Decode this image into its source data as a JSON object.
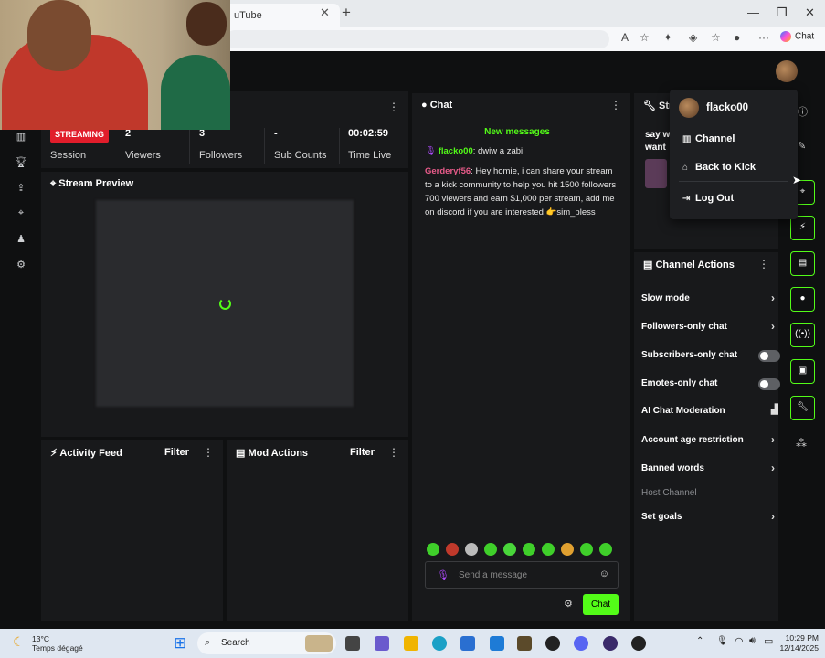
{
  "browser": {
    "tab_title": "uTube",
    "new_tab": "+",
    "chat_label": "Chat"
  },
  "stats": {
    "badge": "STREAMING",
    "session_label": "Session",
    "viewers_value": "2",
    "viewers_label": "Viewers",
    "followers_value": "3",
    "followers_label": "Followers",
    "subs_value": "-",
    "subs_label": "Sub Counts",
    "time_value": "00:02:59",
    "time_label": "Time Live"
  },
  "preview": {
    "title": "Stream Preview"
  },
  "chat": {
    "title": "Chat",
    "new_messages": "New messages",
    "msg1_user": "flacko00",
    "msg1_text": ": dwiw a zabi",
    "msg2_user": "Gerderyf56",
    "msg2_text": ": Hey homie, i can share your stream to a kick community to help you hit 1500 followers 700 viewers and earn $1,000 per stream, add me on discord if you are interested 👉sim_pless",
    "placeholder": "Send a message",
    "send_label": "Chat"
  },
  "activity": {
    "title": "Activity Feed",
    "filter": "Filter"
  },
  "mod": {
    "title": "Mod Actions",
    "filter": "Filter"
  },
  "stream_panel": {
    "title": "Stre",
    "snippet1": "say w",
    "snippet2": "want"
  },
  "channel_actions": {
    "title": "Channel Actions",
    "items": [
      {
        "label": "Slow mode",
        "control": "chevron"
      },
      {
        "label": "Followers-only chat",
        "control": "chevron"
      },
      {
        "label": "Subscribers-only chat",
        "control": "toggle"
      },
      {
        "label": "Emotes-only chat",
        "control": "toggle"
      },
      {
        "label": "AI Chat Moderation",
        "control": "chart"
      },
      {
        "label": "Account age restriction",
        "control": "chevron"
      },
      {
        "label": "Banned words",
        "control": "chevron"
      }
    ],
    "host_channel": "Host Channel",
    "set_goals": "Set goals"
  },
  "popup": {
    "username": "flacko00",
    "channel": "Channel",
    "back_to_kick": "Back to Kick",
    "log_out": "Log Out"
  },
  "taskbar": {
    "temp": "13°C",
    "weather": "Temps dégagé",
    "search": "Search",
    "time": "10:29 PM",
    "date": "12/14/2025"
  },
  "colors": {
    "accent": "#53fc18",
    "live": "#e11d2b",
    "panel": "#18191b",
    "user1": "#53fc18",
    "user2": "#e85b8a"
  }
}
